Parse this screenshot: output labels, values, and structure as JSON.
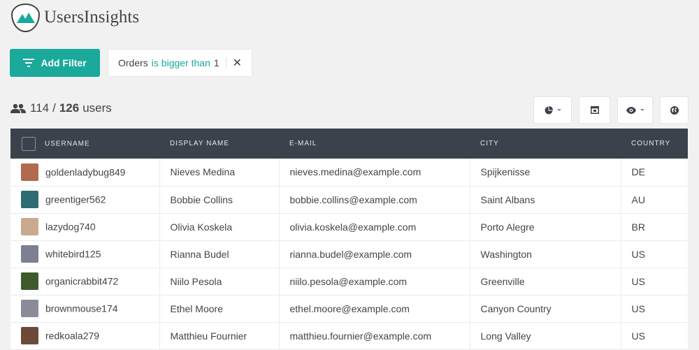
{
  "app": {
    "name": "UsersInsights"
  },
  "filter": {
    "add_label": "Add Filter",
    "chip": {
      "field": "Orders",
      "operator": "is bigger than",
      "value": "1"
    }
  },
  "summary": {
    "shown": "114",
    "separator": "/",
    "total": "126",
    "unit": "users"
  },
  "toolbar": [
    {
      "icon": "pie-chart-icon",
      "has_caret": true
    },
    {
      "icon": "segment-icon",
      "has_caret": false
    },
    {
      "icon": "eye-icon",
      "has_caret": true
    },
    {
      "icon": "globe-icon",
      "has_caret": false
    }
  ],
  "table": {
    "columns": [
      "Username",
      "Display Name",
      "E-mail",
      "City",
      "Country"
    ],
    "rows": [
      {
        "username": "goldenladybug849",
        "display_name": "Nieves Medina",
        "email": "nieves.medina@example.com",
        "city": "Spijkenisse",
        "country": "DE",
        "avatar_color": "#b06a4e"
      },
      {
        "username": "greentiger562",
        "display_name": "Bobbie Collins",
        "email": "bobbie.collins@example.com",
        "city": "Saint Albans",
        "country": "AU",
        "avatar_color": "#2f6b74"
      },
      {
        "username": "lazydog740",
        "display_name": "Olivia Koskela",
        "email": "olivia.koskela@example.com",
        "city": "Porto Alegre",
        "country": "BR",
        "avatar_color": "#c9a98f"
      },
      {
        "username": "whitebird125",
        "display_name": "Rianna Budel",
        "email": "rianna.budel@example.com",
        "city": "Washington",
        "country": "US",
        "avatar_color": "#7d7f93"
      },
      {
        "username": "organicrabbit472",
        "display_name": "Niilo Pesola",
        "email": "niilo.pesola@example.com",
        "city": "Greenville",
        "country": "US",
        "avatar_color": "#3f5b2c"
      },
      {
        "username": "brownmouse174",
        "display_name": "Ethel Moore",
        "email": "ethel.moore@example.com",
        "city": "Canyon Country",
        "country": "US",
        "avatar_color": "#8a8c9a"
      },
      {
        "username": "redkoala279",
        "display_name": "Matthieu Fournier",
        "email": "matthieu.fournier@example.com",
        "city": "Long Valley",
        "country": "US",
        "avatar_color": "#6b4a3a"
      }
    ]
  }
}
